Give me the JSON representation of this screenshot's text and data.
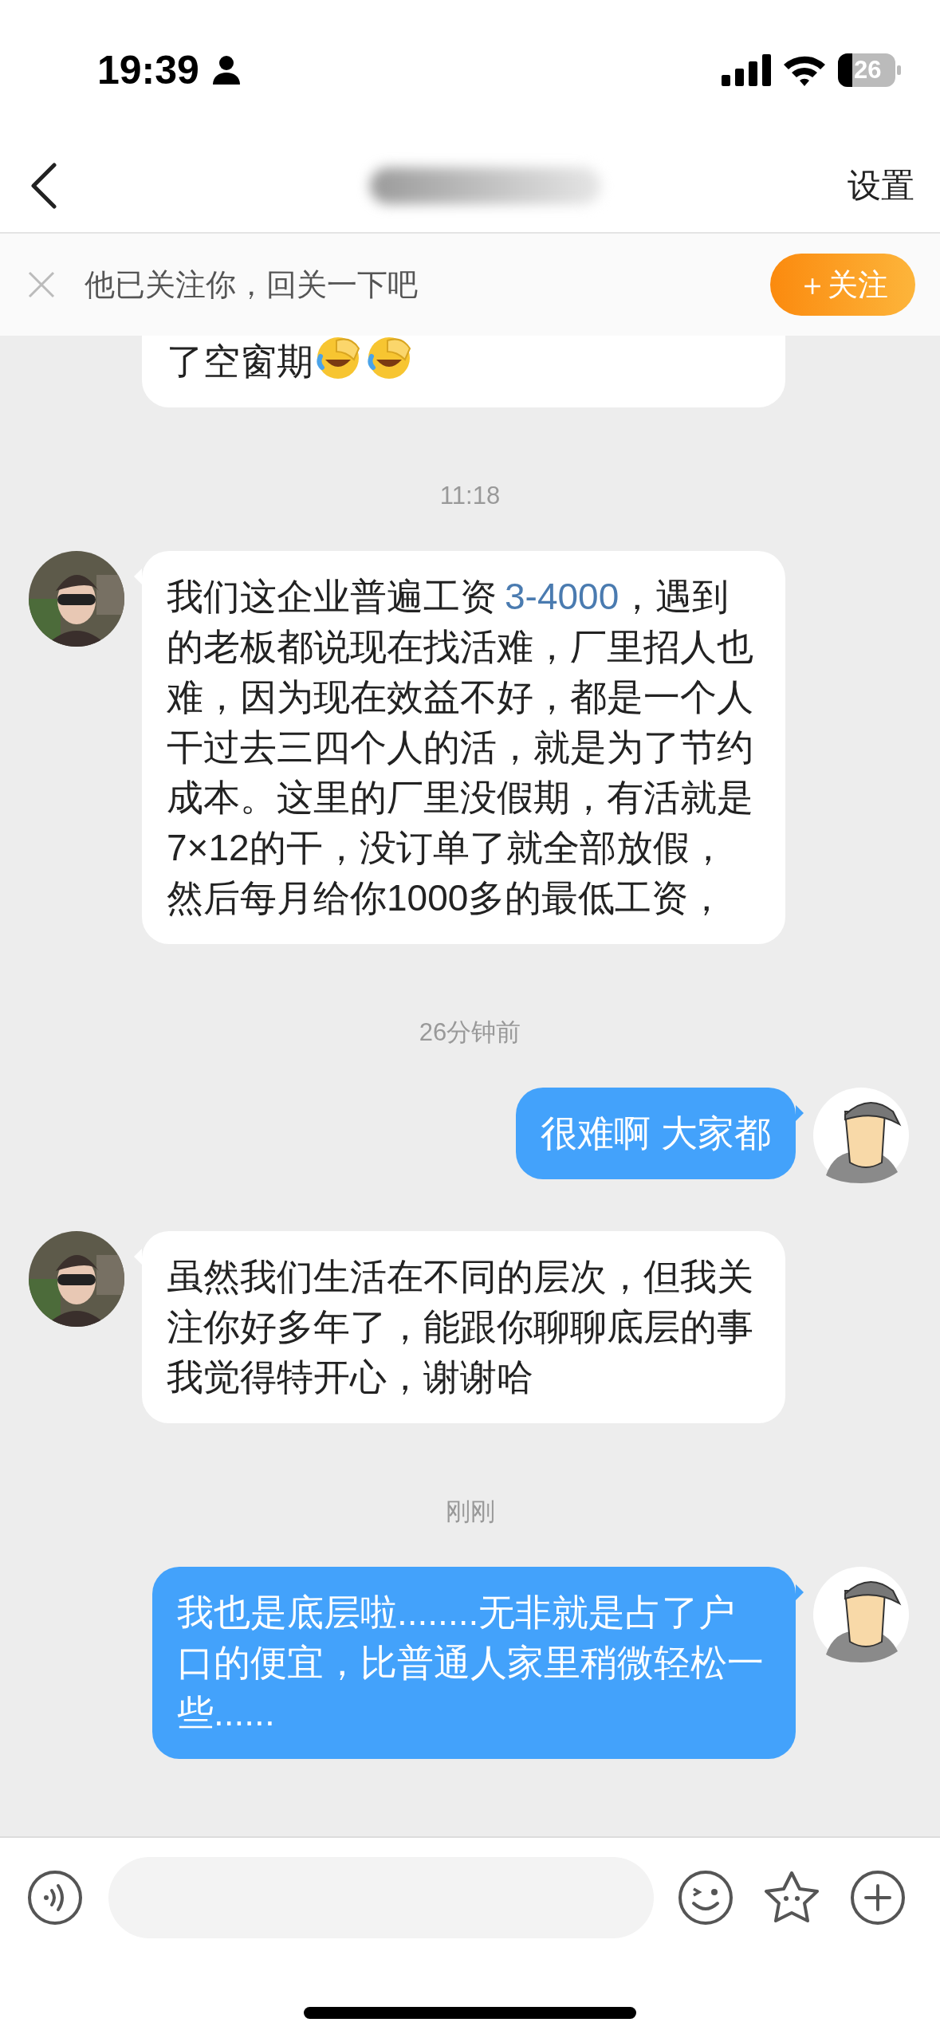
{
  "status_bar": {
    "time": "19:39",
    "battery": "26"
  },
  "nav": {
    "action": "设置"
  },
  "follow_banner": {
    "text": "他已关注你，回关一下吧",
    "button": "＋关注"
  },
  "messages": [
    {
      "kind": "incoming",
      "cut_top": true,
      "segments": [
        {
          "kind": "plain",
          "text": "了空窗期"
        },
        {
          "kind": "emoji"
        },
        {
          "kind": "emoji"
        }
      ]
    },
    {
      "kind": "time",
      "text": "11:18"
    },
    {
      "kind": "incoming",
      "segments": [
        {
          "kind": "plain",
          "text": "我们这企业普遍工资"
        },
        {
          "kind": "link",
          "text": "3-4000"
        },
        {
          "kind": "plain",
          "text": "，遇到的老板都说现在找活难，厂里招人也难，因为现在效益不好，都是一个人干过去三四个人的活，就是为了节约成本。这里的厂里没假期，有活就是7×12的干，没订单了就全部放假，然后每月给你1000多的最低工资，"
        }
      ]
    },
    {
      "kind": "time",
      "text": "26分钟前"
    },
    {
      "kind": "outgoing",
      "segments": [
        {
          "kind": "plain",
          "text": "很难啊 大家都"
        }
      ]
    },
    {
      "kind": "incoming",
      "segments": [
        {
          "kind": "plain",
          "text": "虽然我们生活在不同的层次，但我关注你好多年了，能跟你聊聊底层的事我觉得特开心，谢谢哈"
        }
      ]
    },
    {
      "kind": "time",
      "text": "刚刚"
    },
    {
      "kind": "outgoing",
      "segments": [
        {
          "kind": "plain",
          "text": "我也是底层啦........无非就是占了户口的便宜，比普通人家里稍微轻松一些......"
        }
      ]
    }
  ]
}
